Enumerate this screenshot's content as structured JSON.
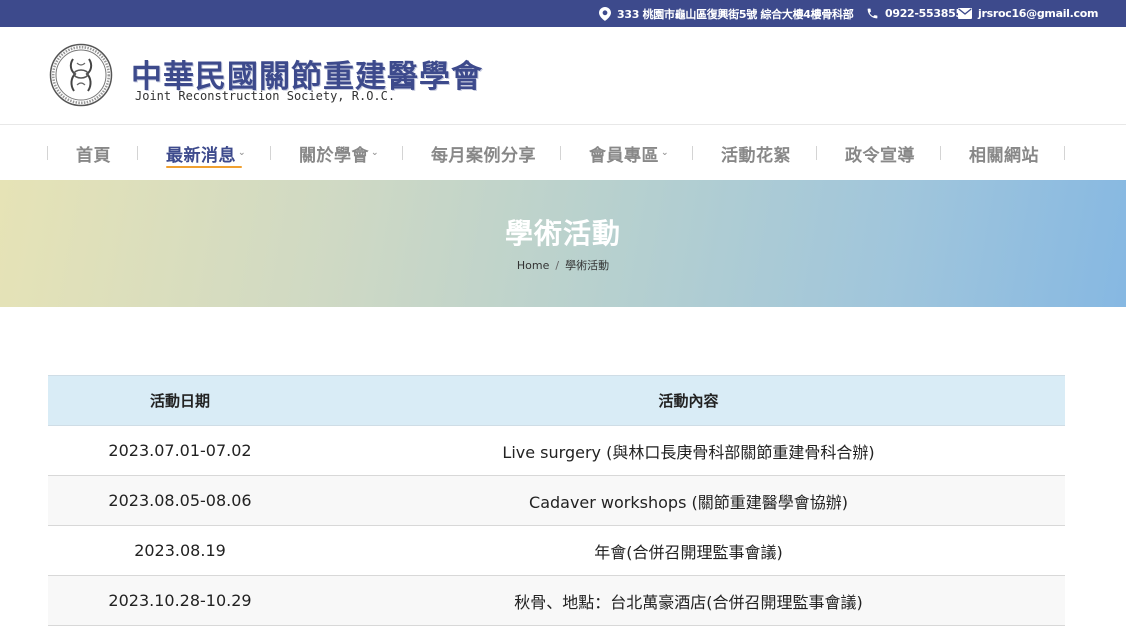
{
  "topbar": {
    "address": "333 桃園市龜山區復興街5號 綜合大樓4樓骨科部",
    "phone": "0922-553855",
    "email": "jrsroc16@gmail.com"
  },
  "header": {
    "logo_title": "中華民國關節重建醫學會",
    "logo_subtitle": "Joint Reconstruction Society, R.O.C."
  },
  "nav": {
    "items": [
      {
        "label": "首頁"
      },
      {
        "label": "最新消息"
      },
      {
        "label": "關於學會"
      },
      {
        "label": "每月案例分享"
      },
      {
        "label": "會員專區"
      },
      {
        "label": "活動花絮"
      },
      {
        "label": "政令宣導"
      },
      {
        "label": "相關網站"
      }
    ],
    "active_index": 1,
    "accent_color": "#f0a030"
  },
  "hero": {
    "title": "學術活動",
    "breadcrumb_home": "Home",
    "breadcrumb_separator": "/",
    "breadcrumb_current": "學術活動"
  },
  "table": {
    "headers": [
      "活動日期",
      "活動內容"
    ],
    "rows": [
      [
        "2023.07.01-07.02",
        "Live surgery (與林口長庚骨科部關節重建骨科合辦)"
      ],
      [
        "2023.08.05-08.06",
        "Cadaver workshops (關節重建醫學會協辦)"
      ],
      [
        "2023.08.19",
        "年會(合併召開理監事會議)"
      ],
      [
        "2023.10.28-10.29",
        "秋骨、地點：台北萬豪酒店(合併召開理監事會議)"
      ]
    ]
  },
  "colors": {
    "brand": "#3d4a8c",
    "table_header_bg": "#d9ecf6"
  }
}
